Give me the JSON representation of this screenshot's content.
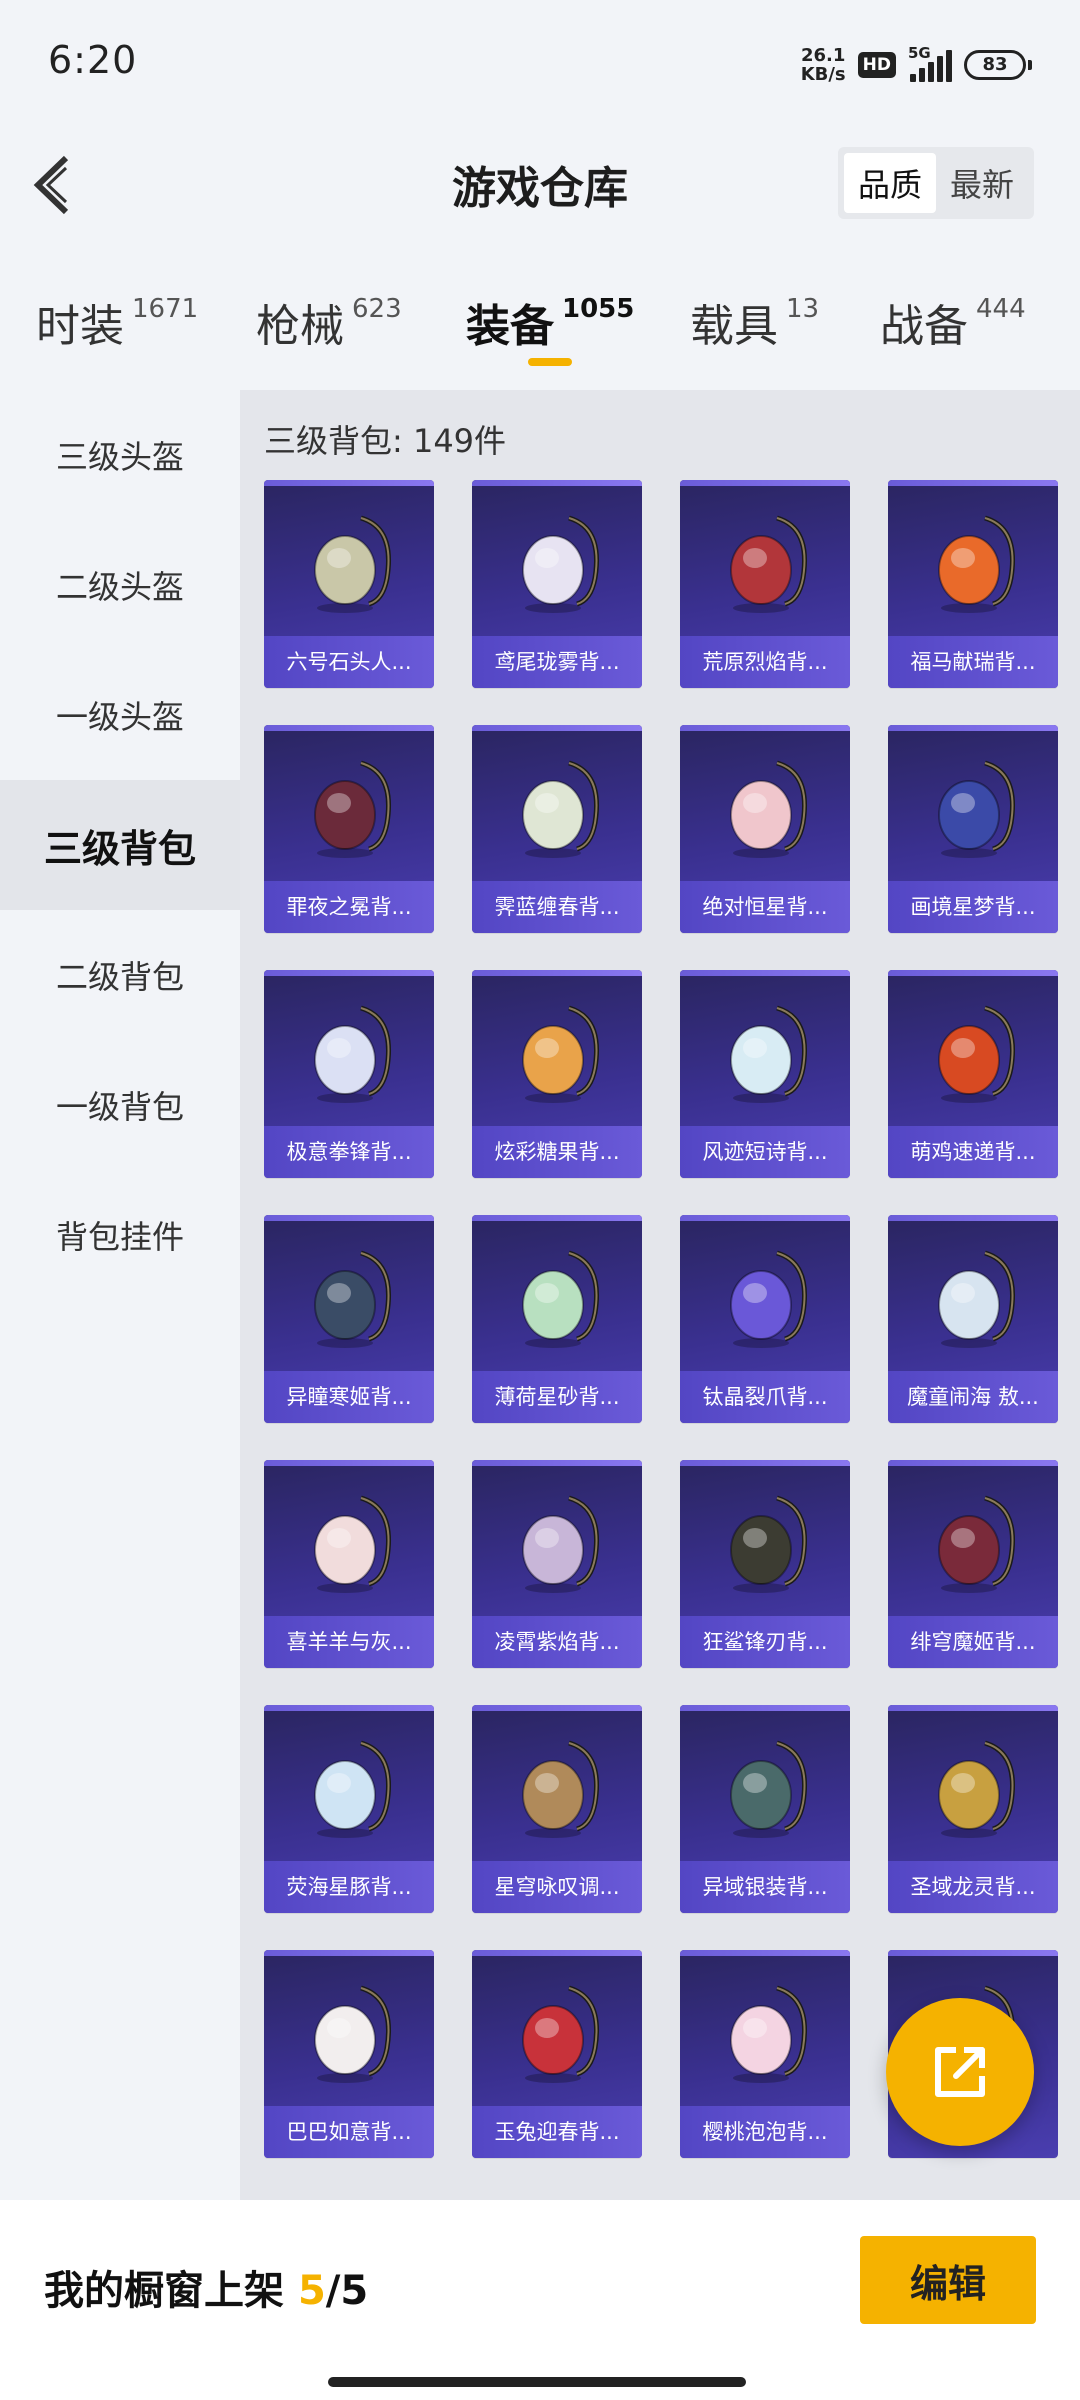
{
  "status_bar": {
    "time": "6:20",
    "net_speed_value": "26.1",
    "net_speed_unit": "KB/s",
    "hd": "HD",
    "network": "5G",
    "battery": "83"
  },
  "header": {
    "title": "游戏仓库",
    "sort_options": [
      "品质",
      "最新"
    ],
    "sort_selected": "品质"
  },
  "tabs": [
    {
      "label": "时装",
      "count": "1671"
    },
    {
      "label": "枪械",
      "count": "623"
    },
    {
      "label": "装备",
      "count": "1055"
    },
    {
      "label": "载具",
      "count": "13"
    },
    {
      "label": "战备",
      "count": "444"
    }
  ],
  "active_tab": "装备",
  "sidebar": {
    "items": [
      "三级头盔",
      "二级头盔",
      "一级头盔",
      "三级背包",
      "二级背包",
      "一级背包",
      "背包挂件"
    ],
    "active": "三级背包"
  },
  "section": {
    "title": "三级背包: 149件"
  },
  "items": [
    {
      "label": "六号石头人...",
      "color": "#c9c7a8"
    },
    {
      "label": "鸢尾珑雾背...",
      "color": "#e7e3f2"
    },
    {
      "label": "荒原烈焰背...",
      "color": "#b2363a"
    },
    {
      "label": "福马献瑞背...",
      "color": "#e96a2a"
    },
    {
      "label": "罪夜之冕背...",
      "color": "#6b2a3a"
    },
    {
      "label": "霁蓝缠春背...",
      "color": "#dfe6d4"
    },
    {
      "label": "绝对恒星背...",
      "color": "#f0c6cc"
    },
    {
      "label": "画境星梦背...",
      "color": "#3b4aa8"
    },
    {
      "label": "极意拳锋背...",
      "color": "#dbe0f4"
    },
    {
      "label": "炫彩糖果背...",
      "color": "#e9a34a"
    },
    {
      "label": "风迹短诗背...",
      "color": "#d8ecf4"
    },
    {
      "label": "萌鸡速递背...",
      "color": "#d84a22"
    },
    {
      "label": "异瞳寒姬背...",
      "color": "#3a4c66"
    },
    {
      "label": "薄荷星砂背...",
      "color": "#b8e0c0"
    },
    {
      "label": "钛晶裂爪背...",
      "color": "#6a58d8"
    },
    {
      "label": "魔童闹海 敖...",
      "color": "#d7e4f0"
    },
    {
      "label": "喜羊羊与灰...",
      "color": "#f1dcdc"
    },
    {
      "label": "凌霄紫焰背...",
      "color": "#c8b6d8"
    },
    {
      "label": "狂鲨锋刃背...",
      "color": "#3c3c32"
    },
    {
      "label": "绯穹魔姬背...",
      "color": "#7a2a3a"
    },
    {
      "label": "荧海星豚背...",
      "color": "#cfe4f4"
    },
    {
      "label": "星穹咏叹调...",
      "color": "#b08a5a"
    },
    {
      "label": "异域银装背...",
      "color": "#4a6a6a"
    },
    {
      "label": "圣域龙灵背...",
      "color": "#c8a040"
    },
    {
      "label": "巴巴如意背...",
      "color": "#f2eeee"
    },
    {
      "label": "玉兔迎春背...",
      "color": "#c8323a"
    },
    {
      "label": "樱桃泡泡背...",
      "color": "#f4d4e2"
    },
    {
      "label": "",
      "color": "#e6d6b0"
    }
  ],
  "bottom": {
    "showcase_prefix": "我的橱窗上架 ",
    "showcase_current": "5",
    "showcase_sep": "/",
    "showcase_total": "5",
    "edit_label": "编辑"
  },
  "colors": {
    "accent": "#f5b200",
    "card_gradient_top": "#2a2560",
    "card_label": "#5a4cc8"
  },
  "icons": {
    "back": "chevron-left-icon",
    "share": "share-external-icon"
  }
}
